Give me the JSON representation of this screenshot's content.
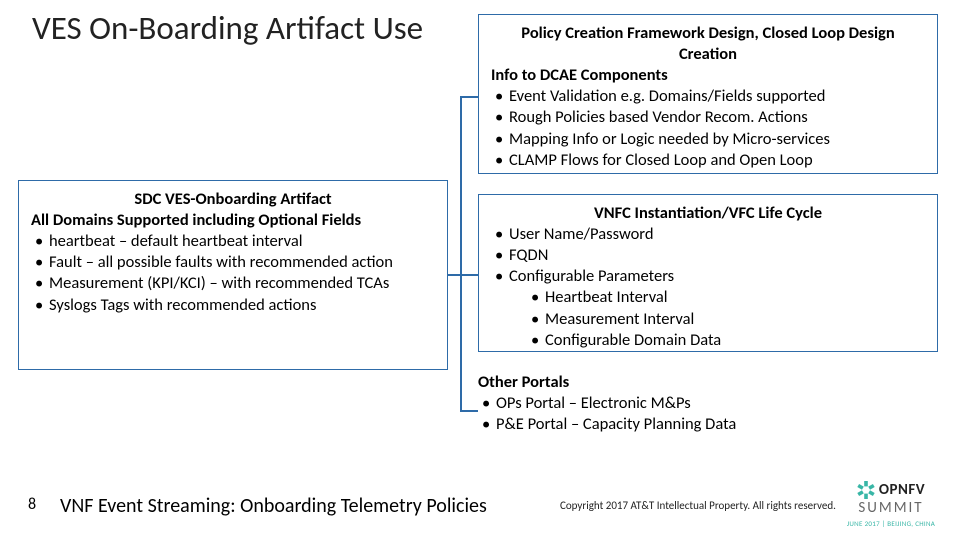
{
  "title": "VES On-Boarding Artifact Use",
  "left_box": {
    "heading": "SDC VES-Onboarding Artifact",
    "sub": "All Domains Supported including Optional Fields",
    "items": [
      "heartbeat – default heartbeat interval",
      "Fault – all possible faults with recommended action",
      "Measurement (KPI/KCI) – with recommended TCAs",
      "Syslogs Tags with recommended actions"
    ]
  },
  "top_right": {
    "heading1": "Policy Creation Framework Design, Closed Loop Design Creation",
    "sub": "Info to DCAE Components",
    "items": [
      "Event Validation e.g. Domains/Fields supported",
      "Rough Policies based Vendor Recom. Actions",
      "Mapping Info or Logic needed by Micro-services",
      "CLAMP Flows for Closed Loop and Open Loop"
    ]
  },
  "mid_right": {
    "heading": "VNFC Instantiation/VFC Life Cycle",
    "items": [
      "User Name/Password",
      "FQDN",
      "Configurable Parameters"
    ],
    "sub_items": [
      "Heartbeat Interval",
      "Measurement Interval",
      "Configurable Domain Data"
    ]
  },
  "bot_right": {
    "heading": "Other Portals",
    "items": [
      "OPs Portal – Electronic M&Ps",
      "P&E Portal – Capacity Planning Data"
    ]
  },
  "page_num": "8",
  "subtitle": "VNF Event Streaming: Onboarding Telemetry Policies",
  "copyright": "Copyright 2017 AT&T Intellectual Property. All rights reserved.",
  "logo": {
    "brand": "OPNFV",
    "event": "SUMMIT",
    "tag": "JUNE 2017 | BEIJING, CHINA"
  }
}
